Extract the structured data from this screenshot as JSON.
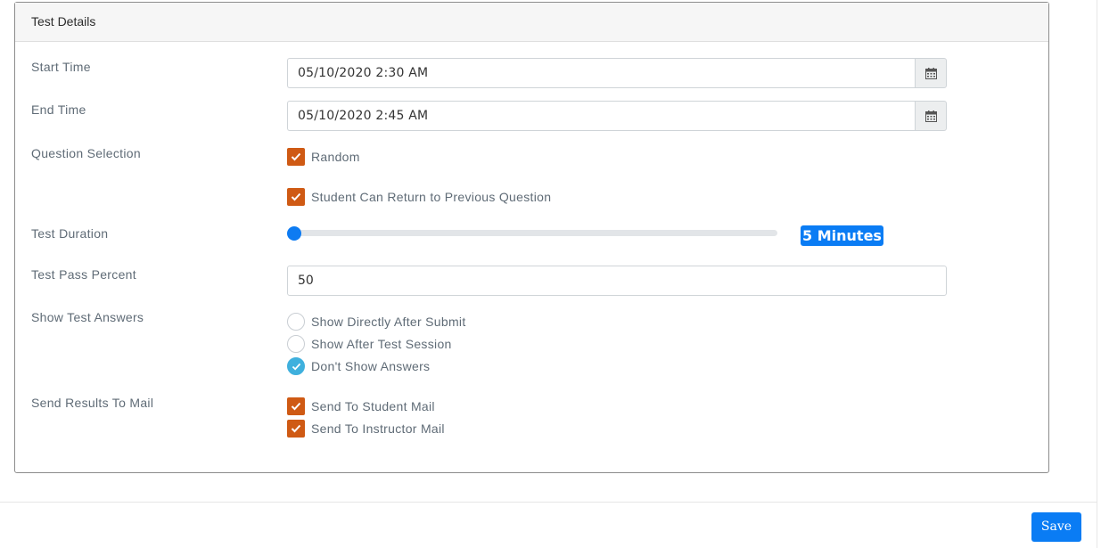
{
  "panel": {
    "title": "Test Details"
  },
  "fields": {
    "start_time": {
      "label": "Start Time",
      "value": "05/10/2020 2:30 AM",
      "icon": "calendar-icon"
    },
    "end_time": {
      "label": "End Time",
      "value": "05/10/2020 2:45 AM",
      "icon": "calendar-icon"
    },
    "question_selection": {
      "label": "Question Selection",
      "options": [
        {
          "label": "Random",
          "checked": true
        },
        {
          "label": "Student Can Return to Previous Question",
          "checked": true
        }
      ]
    },
    "test_duration": {
      "label": "Test Duration",
      "badge": "5 Minutes",
      "slider_fraction": 0.0
    },
    "pass_percent": {
      "label": "Test Pass Percent",
      "value": "50"
    },
    "show_answers": {
      "label": "Show Test Answers",
      "options": [
        {
          "label": "Show Directly After Submit",
          "selected": false
        },
        {
          "label": "Show After Test Session",
          "selected": false
        },
        {
          "label": "Don't Show Answers",
          "selected": true
        }
      ]
    },
    "send_results": {
      "label": "Send Results To Mail",
      "options": [
        {
          "label": "Send To Student Mail",
          "checked": true
        },
        {
          "label": "Send To Instructor Mail",
          "checked": true
        }
      ]
    }
  },
  "footer": {
    "save_label": "Save"
  },
  "colors": {
    "checkbox": "#cf5a14",
    "radio_selected": "#3fb0dd",
    "primary": "#0a7cf4"
  }
}
